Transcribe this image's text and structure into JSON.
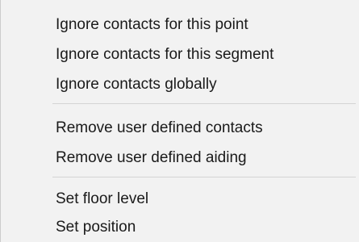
{
  "context_menu": {
    "groups": [
      {
        "items": [
          {
            "label": "Ignore contacts for this point"
          },
          {
            "label": "Ignore contacts for this segment"
          },
          {
            "label": "Ignore contacts globally"
          }
        ]
      },
      {
        "items": [
          {
            "label": "Remove user defined contacts"
          },
          {
            "label": "Remove user defined aiding"
          }
        ]
      },
      {
        "items": [
          {
            "label": "Set floor level"
          },
          {
            "label": "Set position"
          }
        ]
      }
    ]
  }
}
